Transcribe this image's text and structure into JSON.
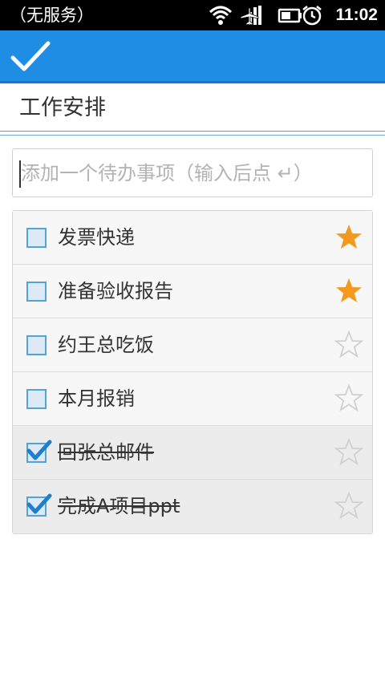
{
  "status_bar": {
    "carrier": "（无服务）",
    "time": "11:02",
    "icons": [
      "wifi-icon",
      "airplane-mode-icon",
      "battery-icon",
      "alarm-icon"
    ]
  },
  "action_bar": {
    "confirm_icon": "checkmark-icon",
    "background": "#1e8de3"
  },
  "list_title": "工作安排",
  "add_input": {
    "placeholder": "添加一个待办事项（输入后点 ↵）",
    "value": ""
  },
  "colors": {
    "star_active": "#f39a1e",
    "star_inactive": "#d0d0d0",
    "checkbox_border": "#52a3d8"
  },
  "items": [
    {
      "text": "发票快递",
      "done": false,
      "starred": true
    },
    {
      "text": "准备验收报告",
      "done": false,
      "starred": true
    },
    {
      "text": "约王总吃饭",
      "done": false,
      "starred": false
    },
    {
      "text": "本月报销",
      "done": false,
      "starred": false
    },
    {
      "text": "回张总邮件",
      "done": true,
      "starred": false
    },
    {
      "text": "完成A项目ppt",
      "done": true,
      "starred": false
    }
  ]
}
